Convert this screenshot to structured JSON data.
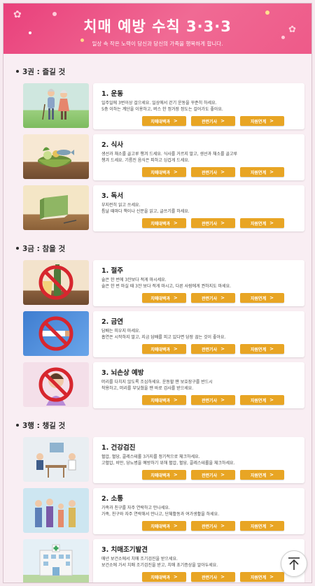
{
  "header": {
    "title": "치매 예방 수칙 3·3·3",
    "subtitle": "일상 속 작은 노력이 당신과 당신의 가족을 행복하게 합니다."
  },
  "sections": [
    {
      "title": "3권 : 즐길 것",
      "items": [
        {
          "title": "1. 운동",
          "desc1": "일주일에 3번이상 걸으세요. 일상에서 걷기 운동을 꾸준히 하세요.",
          "desc2": "5층 이하는 계단을 이용하고, 버스 한 정거장 정도는 걸어가도 좋아요.",
          "thumb": "exercise"
        },
        {
          "title": "2. 식사",
          "desc1": "생선과 채소를 골고루 챙겨 드세요. 식사를 거르지 말고, 생선과 채소를 골고루",
          "desc2": "챙겨 드세요. 기름진 음식은 피하고 싱겁게 드세요.",
          "thumb": "meal"
        },
        {
          "title": "3. 독서",
          "desc1": "부지런히 읽고 쓰세요.",
          "desc2": "틈날 때마다 책이나 신문을 읽고, 글쓰기를 하세요.",
          "thumb": "reading"
        }
      ]
    },
    {
      "title": "3금 : 참을 것",
      "items": [
        {
          "title": "1. 절주",
          "desc1": "술은 한 번에 3잔보다 적게 마시세요.",
          "desc2": "술은 한 번 마실 때 3잔 보다 적게 마시고, 다른 사람에게 권하지도 마세요.",
          "thumb": "alcohol"
        },
        {
          "title": "2. 금연",
          "desc1": "담배는 피우지 마세요.",
          "desc2": "흡연은 시작하지 말고, 지금 담배를 피고 있다면 당장 끊는 것이 좋아요.",
          "thumb": "smoking"
        },
        {
          "title": "3. 뇌손상 예방",
          "desc1": "머리를 다치지 않도록 조심하세요. 운동할 땐 보호장구를 반드시",
          "desc2": "착용하고, 머리를 부딪쳤을 땐 바로 검사를 받으세요.",
          "thumb": "head"
        }
      ]
    },
    {
      "title": "3행 : 챙길 것",
      "items": [
        {
          "title": "1. 건강검진",
          "desc1": "혈압, 혈당, 콜레스테롤 3가지를 정기적으로 체크하세요.",
          "desc2": "고혈압, 비만, 당뇨병을 예방하기 위해 혈압, 혈당, 콜레스테롤을 체크하세요.",
          "thumb": "checkup"
        },
        {
          "title": "2. 소통",
          "desc1": "가족과 친구를 자주 연락하고 만나세요.",
          "desc2": "가족, 친구와 자주 연락해서 만나고, 단체활동과 여가생활을 하세요.",
          "thumb": "family"
        },
        {
          "title": "3. 치매조기발견",
          "desc1": "매년 보건소에서 치매 조기검진을 받으세요.",
          "desc2": "보건소에 가서 치매 조기검진을 받고, 치매 초기증상을 알아두세요.",
          "thumb": "hospital"
        }
      ]
    }
  ],
  "buttons": {
    "b1": "치매대백과",
    "b2": "관련기사",
    "b3": "자원연계",
    "arrow": ">"
  },
  "colors": {
    "header": "#e9407b",
    "button": "#e8a524",
    "background": "#f9eef3"
  },
  "icons": {
    "scroll_top": "arrow-up-icon"
  }
}
